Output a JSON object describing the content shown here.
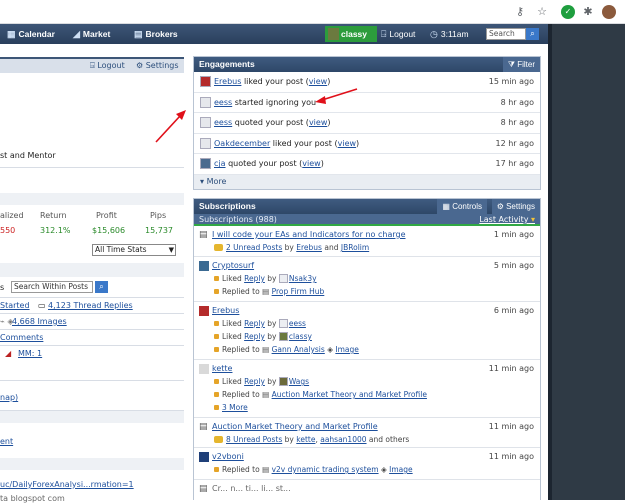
{
  "navbar": {
    "calendar": "Calendar",
    "market": "Market",
    "brokers": "Brokers",
    "user": "classy",
    "logout": "Logout",
    "time": "3:11am",
    "search_placeholder": "Search"
  },
  "left_panel": {
    "logout": "Logout",
    "settings": "Settings",
    "role_text": "st and Mentor",
    "stats_headers": [
      "alized",
      "Return",
      "Profit",
      "Pips"
    ],
    "stats_values": [
      "550",
      "312.1%",
      "$15,606",
      "15,737"
    ],
    "stats_filter": "All Time Stats",
    "search_posts_value": "Search Within Posts",
    "links": {
      "started": "Started",
      "thread_replies": "4,123 Thread Replies",
      "images": "4,668 Images",
      "comments": "Comments",
      "mm": "MM: 1",
      "map": "nap)",
      "ent": "ent",
      "url": "uc/DailyForexAnalysi...rmation=1"
    },
    "cut_text": "ta blogspot com"
  },
  "engagements": {
    "title": "Engagements",
    "filter": "Filter",
    "items": [
      {
        "user": "Erebus",
        "action": "liked your post",
        "link": "view",
        "time": "15 min ago"
      },
      {
        "user": "eess",
        "action": "started ignoring you",
        "link": "",
        "time": "8 hr ago"
      },
      {
        "user": "eess",
        "action": "quoted your post",
        "link": "view",
        "time": "8 hr ago"
      },
      {
        "user": "Oakdecember",
        "action": "liked your post",
        "link": "view",
        "time": "12 hr ago"
      },
      {
        "user": "cja",
        "action": "quoted your post",
        "link": "view",
        "time": "17 hr ago"
      }
    ],
    "more": "More"
  },
  "subscriptions": {
    "title": "Subscriptions",
    "controls": "Controls",
    "settings": "Settings",
    "count_label": "Subscriptions (988)",
    "sort_label": "Last Activity",
    "items": [
      {
        "title": "I will code your EAs and Indicators for no charge",
        "time": "1 min ago",
        "unread": "2 Unread Posts",
        "by": "by",
        "by1": "Erebus",
        "and": "and",
        "by2": "JBRolim"
      },
      {
        "title": "Cryptosurf",
        "time": "5 min ago",
        "liked": "Liked",
        "reply": "Reply",
        "by": "by",
        "user": "Nsak3y",
        "replied": "Replied to",
        "thread": "Prop Firm Hub"
      },
      {
        "title": "Erebus",
        "time": "6 min ago",
        "liked": "Liked",
        "reply": "Reply",
        "by": "by",
        "user": "eess",
        "liked2": "Liked",
        "reply2": "Reply",
        "user2": "classy",
        "replied": "Replied to",
        "thread": "Gann Analysis",
        "image": "Image"
      },
      {
        "title": "kette",
        "time": "11 min ago",
        "liked": "Liked",
        "reply": "Reply",
        "by": "by",
        "user": "Wags",
        "replied": "Replied to",
        "thread": "Auction Market Theory and Market Profile",
        "more": "3 More"
      },
      {
        "title": "Auction Market Theory and Market Profile",
        "time": "11 min ago",
        "unread": "8 Unread Posts",
        "by": "by",
        "by1": "kette",
        "by2": "aahsan1000",
        "others": "and others"
      },
      {
        "title": "v2vboni",
        "time": "11 min ago",
        "replied": "Replied to",
        "thread": "v2v dynamic trading system",
        "image": "Image"
      },
      {
        "title": "Cr... n... ti... li... st...",
        "time": ""
      }
    ]
  }
}
